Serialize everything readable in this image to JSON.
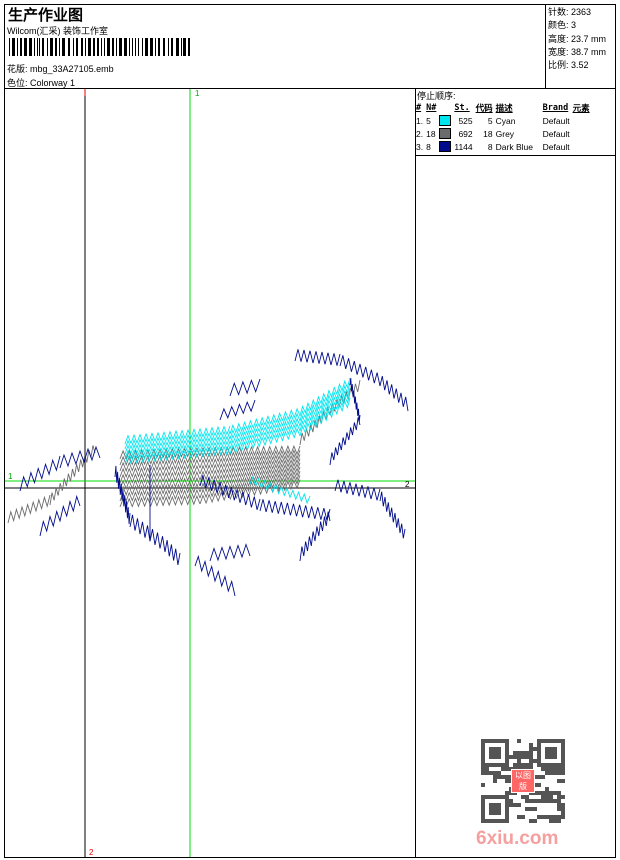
{
  "header": {
    "title": "生产作业图",
    "studio": "Wilcom(汇采) 装饰工作室",
    "design_label": "花版:",
    "design_value": "mbg_33A27105.emb",
    "colorway_label": "色位:",
    "colorway_value": "Colorway 1"
  },
  "stats": [
    {
      "label": "针数:",
      "value": "2363"
    },
    {
      "label": "颜色:",
      "value": "3"
    },
    {
      "label": "高度:",
      "value": "23.7 mm"
    },
    {
      "label": "宽度:",
      "value": "38.7 mm"
    },
    {
      "label": "比例:",
      "value": "3.52"
    }
  ],
  "stop_sequence": {
    "title": "停止顺序:",
    "columns": [
      "#",
      "N#",
      "",
      "St.",
      "代码",
      "描述",
      "Brand",
      "元素"
    ],
    "rows": [
      {
        "idx": "1.",
        "n": "5",
        "color": "#00e5ee",
        "st": "525",
        "code": "5",
        "desc": "Cyan",
        "brand": "Default"
      },
      {
        "idx": "2.",
        "n": "18",
        "color": "#6b6b6b",
        "st": "692",
        "code": "18",
        "desc": "Grey",
        "brand": "Default"
      },
      {
        "idx": "3.",
        "n": "8",
        "color": "#000c8c",
        "st": "1144",
        "code": "8",
        "desc": "Dark Blue",
        "brand": "Default"
      }
    ]
  },
  "guides": {
    "v_top": "1",
    "h_left": "1",
    "h_right": "2",
    "v_bottom": "2"
  },
  "watermark": {
    "stamp": "以图版",
    "site": "6xiu.com"
  }
}
